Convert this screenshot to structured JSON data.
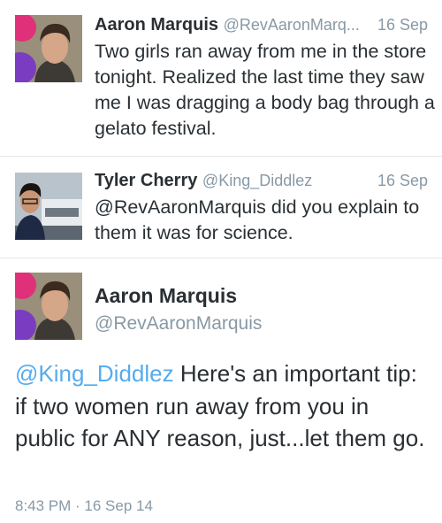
{
  "tweets": [
    {
      "name": "Aaron Marquis",
      "handle": "@RevAaronMarq...",
      "date": "16 Sep",
      "avatar_icon": "avatar-aaron-photo",
      "text": "Two girls ran away from me in the store tonight. Realized the last time they saw me I was dragging a body bag through a gelato festival."
    },
    {
      "name": "Tyler Cherry",
      "handle": "@King_Diddlez",
      "date": "16 Sep",
      "avatar_icon": "avatar-tyler-photo",
      "text": "@RevAaronMarquis did you explain to them it was for science."
    }
  ],
  "main_tweet": {
    "name": "Aaron Marquis",
    "handle": "@RevAaronMarquis",
    "avatar_icon": "avatar-aaron-photo",
    "mention": "@King_Diddlez",
    "text": " Here's an important tip: if two women run away from you in public for ANY reason, just...let them go.",
    "timestamp": "8:43 PM · 16 Sep 14"
  },
  "colors": {
    "link": "#55acee",
    "secondary_text": "#8899a6",
    "primary_text": "#292f33",
    "divider": "#e1e8ed"
  }
}
